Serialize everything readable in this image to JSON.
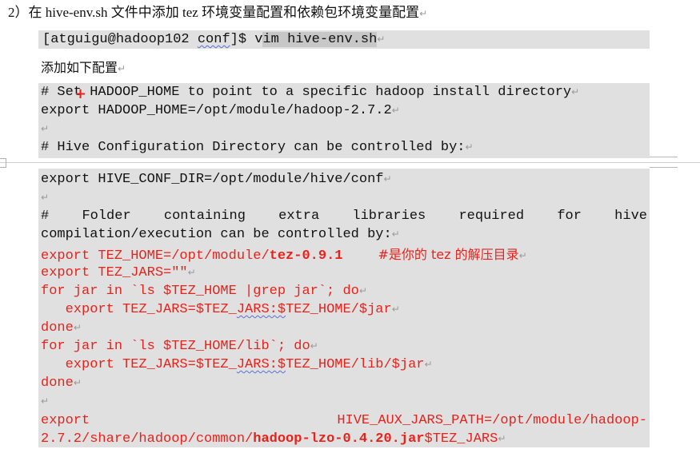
{
  "heading": {
    "number": "2）",
    "text_a": "在 ",
    "file": "hive-env.sh",
    "text_b": " 文件中添加 ",
    "tez": "tez",
    "text_c": " 环境变量配置和依赖包环境变量配置"
  },
  "cmd": {
    "prompt_user": "[atguigu@hadoop102 ",
    "prompt_dir": "conf",
    "prompt_end": "]$ ",
    "cmd_v": "v",
    "cmd_rest": "im hive-env.sh"
  },
  "intro_text": "添加如下配置",
  "box1": {
    "l1": "# Set HADOOP_HOME to point to a specific hadoop install directory",
    "l2": "export HADOOP_HOME=/opt/module/hadoop-2.7.2",
    "l4": "# Hive Configuration Directory can be controlled by:"
  },
  "box2": {
    "l1": "export HIVE_CONF_DIR=/opt/module/hive/conf",
    "l3_words": [
      "#",
      "Folder",
      "containing",
      "extra",
      "libraries",
      "required",
      "for",
      "hive"
    ],
    "l4": "compilation/execution can be controlled by:",
    "l5_a": "export TEZ_HOME=/opt/module/",
    "l5_b": "tez-0.9.1",
    "l5_c": "#是你的 tez 的解压目录",
    "l6": "export TEZ_JARS=\"\"",
    "l7": "for jar in `ls $TEZ_HOME |grep jar`; do",
    "l8_a": "   export TEZ_JARS=$TEZ_",
    "l8_b": "JARS:$",
    "l8_c": "TEZ_HOME/$jar",
    "l9": "done",
    "l10": "for jar in `ls $TEZ_HOME/lib`; do",
    "l11_a": "   export TEZ_JARS=$TEZ_",
    "l11_b": "JARS:$",
    "l11_c": "TEZ_HOME/lib/$jar",
    "l12": "done",
    "l14_a": "export",
    "l14_b": "HIVE_AUX_JARS_PATH=/opt/module/hadoop-",
    "l15_a": "2.7.2/share/hadoop/common/",
    "l15_b": "hadoop-lzo-0.4.20.jar",
    "l15_c": "$TEZ_JARS"
  },
  "para_mark": "↵",
  "colors": {
    "code_bg": "#e0e0e0",
    "red": "#e8221b",
    "selection": "#c7c7c7"
  }
}
